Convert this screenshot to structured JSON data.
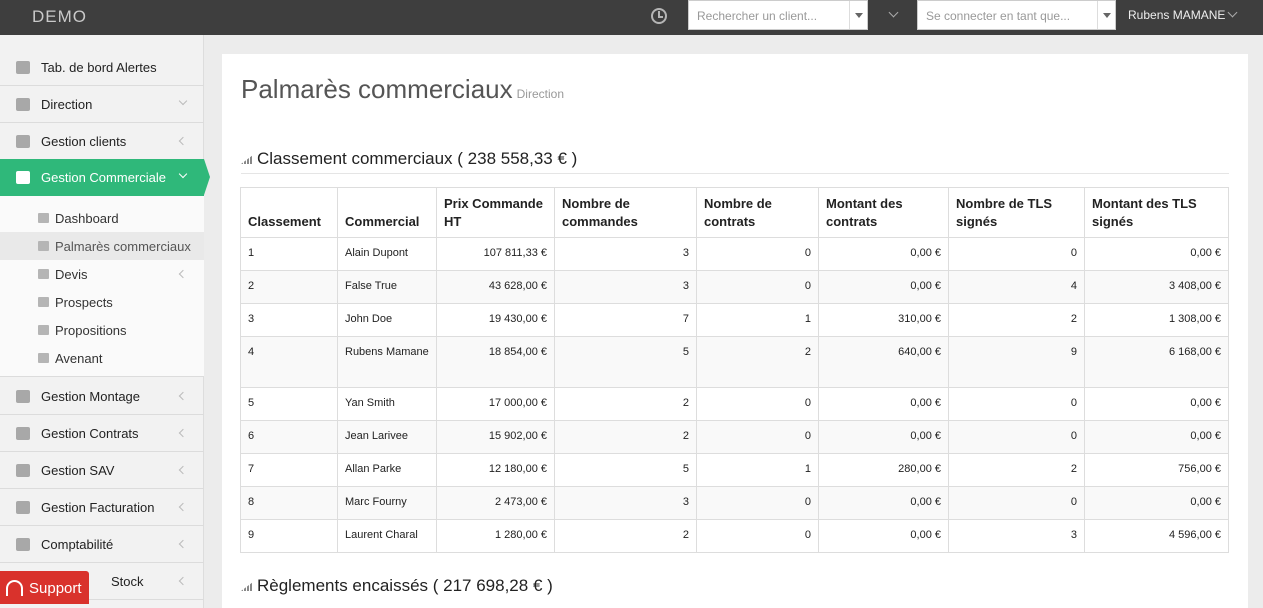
{
  "app": {
    "brand": "DEMO"
  },
  "header": {
    "client_search_placeholder": "Rechercher un client...",
    "login_as_placeholder": "Se connecter en tant que...",
    "user_name": "Rubens MAMANE"
  },
  "sidebar": {
    "items": [
      {
        "label": "Tab. de bord Alertes",
        "icon": "dashboard-icon"
      },
      {
        "label": "Direction",
        "icon": "home-icon"
      },
      {
        "label": "Gestion clients",
        "icon": "users-icon"
      },
      {
        "label": "Gestion Commerciale",
        "icon": "sitemap-icon"
      },
      {
        "label": "Gestion Montage",
        "icon": "cogs-icon"
      },
      {
        "label": "Gestion Contrats",
        "icon": "file-icon"
      },
      {
        "label": "Gestion SAV",
        "icon": "cogs-icon"
      },
      {
        "label": "Gestion Facturation",
        "icon": "pencil-icon"
      },
      {
        "label": "Comptabilité",
        "icon": "euro-icon"
      },
      {
        "label": "Stock",
        "icon": "box-icon"
      }
    ],
    "sub_items": [
      {
        "label": "Dashboard",
        "icon": "dashboard-icon"
      },
      {
        "label": "Palmarès commerciaux",
        "icon": "signal-icon"
      },
      {
        "label": "Devis",
        "icon": "thumbs-up-icon"
      },
      {
        "label": "Prospects",
        "icon": "user-icon"
      },
      {
        "label": "Propositions",
        "icon": "file-icon"
      },
      {
        "label": "Avenant",
        "icon": "file-icon"
      }
    ],
    "support_label": "Support"
  },
  "page": {
    "title": "Palmarès commerciaux",
    "subtitle": "Direction",
    "section1_title": "Classement commerciaux ( 238 558,33 € )",
    "section2_title": "Règlements encaissés ( 217 698,28 € )"
  },
  "table": {
    "headers": [
      "Classement",
      "Commercial",
      "Prix Commande HT",
      "Nombre de commandes",
      "Nombre de contrats",
      "Montant des contrats",
      "Nombre de TLS signés",
      "Montant des TLS signés"
    ],
    "rows": [
      [
        "1",
        "Alain Dupont",
        "107 811,33  €",
        "3",
        "0",
        "0,00  €",
        "0",
        "0,00  €"
      ],
      [
        "2",
        "False True",
        "43 628,00  €",
        "3",
        "0",
        "0,00  €",
        "4",
        "3 408,00  €"
      ],
      [
        "3",
        "John Doe",
        "19 430,00  €",
        "7",
        "1",
        "310,00  €",
        "2",
        "1 308,00  €"
      ],
      [
        "4",
        "Rubens Mamane",
        "18 854,00  €",
        "5",
        "2",
        "640,00  €",
        "9",
        "6 168,00  €"
      ],
      [
        "5",
        "Yan Smith",
        "17 000,00  €",
        "2",
        "0",
        "0,00  €",
        "0",
        "0,00  €"
      ],
      [
        "6",
        "Jean Larivee",
        "15 902,00  €",
        "2",
        "0",
        "0,00  €",
        "0",
        "0,00  €"
      ],
      [
        "7",
        "Allan Parke",
        "12 180,00  €",
        "5",
        "1",
        "280,00  €",
        "2",
        "756,00  €"
      ],
      [
        "8",
        "Marc Fourny",
        "2 473,00  €",
        "3",
        "0",
        "0,00  €",
        "0",
        "0,00  €"
      ],
      [
        "9",
        "Laurent Charal",
        "1 280,00  €",
        "2",
        "0",
        "0,00  €",
        "3",
        "4 596,00  €"
      ]
    ]
  }
}
